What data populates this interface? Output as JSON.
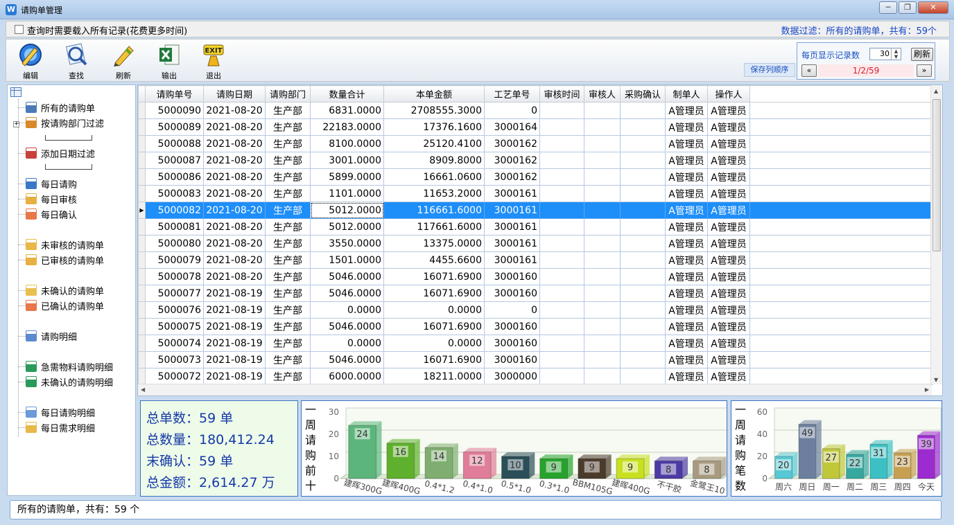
{
  "window": {
    "title": "请购单管理",
    "controls": [
      "─",
      "❐",
      "✕"
    ]
  },
  "options": {
    "load_all_label": "查询时需要载入所有记录(花费更多时间)",
    "load_all_checked": false,
    "filter_text": "数据过滤：所有的请购单，共有：59个"
  },
  "toolbar": {
    "edit": "编辑",
    "find": "查找",
    "refresh": "刷新",
    "export": "输出",
    "exit": "退出",
    "exit_badge": "EXIT",
    "save_column_order": "保存列顺序"
  },
  "pager": {
    "per_page_label": "每页显示记录数",
    "per_page_value": "30",
    "refresh": "刷新",
    "prev": "«",
    "next": "»",
    "page": "1/2/59"
  },
  "sidebar": {
    "items": [
      {
        "label": "所有的请购单",
        "icon": "form-icon"
      },
      {
        "label": "按请购部门过滤",
        "icon": "home-icon"
      },
      {
        "label": "添加日期过滤",
        "icon": "calendar-icon"
      },
      {
        "label": "每日请购",
        "icon": "edit-icon"
      },
      {
        "label": "每日审核",
        "icon": "pencil-folder-icon"
      },
      {
        "label": "每日确认",
        "icon": "heart-folder-icon"
      },
      {
        "label": "未审核的请购单",
        "icon": "open-folder-icon"
      },
      {
        "label": "已审核的请购单",
        "icon": "pencil-folder-icon"
      },
      {
        "label": "未确认的请购单",
        "icon": "grid-folder-icon"
      },
      {
        "label": "已确认的请购单",
        "icon": "heart-folder-icon"
      },
      {
        "label": "请购明细",
        "icon": "note-icon"
      },
      {
        "label": "急需物料请购明细",
        "icon": "urgent-icon"
      },
      {
        "label": "未确认的请购明细",
        "icon": "urgent-icon"
      },
      {
        "label": "每日请购明细",
        "icon": "document-icon"
      },
      {
        "label": "每日需求明细",
        "icon": "document-star-icon"
      }
    ]
  },
  "table": {
    "columns": [
      "请购单号",
      "请购日期",
      "请购部门",
      "数量合计",
      "本单金额",
      "工艺单号",
      "审核时间",
      "审核人",
      "采购确认",
      "制单人",
      "操作人"
    ],
    "rows": [
      [
        "5000090",
        "2021-08-20",
        "生产部",
        "6831.0000",
        "2708555.3000",
        "0",
        "",
        "",
        "",
        "A管理员",
        "A管理员"
      ],
      [
        "5000089",
        "2021-08-20",
        "生产部",
        "22183.0000",
        "17376.1600",
        "3000164",
        "",
        "",
        "",
        "A管理员",
        "A管理员"
      ],
      [
        "5000088",
        "2021-08-20",
        "生产部",
        "8100.0000",
        "25120.4100",
        "3000162",
        "",
        "",
        "",
        "A管理员",
        "A管理员"
      ],
      [
        "5000087",
        "2021-08-20",
        "生产部",
        "3001.0000",
        "8909.8000",
        "3000162",
        "",
        "",
        "",
        "A管理员",
        "A管理员"
      ],
      [
        "5000086",
        "2021-08-20",
        "生产部",
        "5899.0000",
        "16661.0600",
        "3000162",
        "",
        "",
        "",
        "A管理员",
        "A管理员"
      ],
      [
        "5000083",
        "2021-08-20",
        "生产部",
        "1101.0000",
        "11653.2000",
        "3000161",
        "",
        "",
        "",
        "A管理员",
        "A管理员"
      ],
      [
        "5000082",
        "2021-08-20",
        "生产部",
        "5012.0000",
        "116661.6000",
        "3000161",
        "",
        "",
        "",
        "A管理员",
        "A管理员"
      ],
      [
        "5000081",
        "2021-08-20",
        "生产部",
        "5012.0000",
        "117661.6000",
        "3000161",
        "",
        "",
        "",
        "A管理员",
        "A管理员"
      ],
      [
        "5000080",
        "2021-08-20",
        "生产部",
        "3550.0000",
        "13375.0000",
        "3000161",
        "",
        "",
        "",
        "A管理员",
        "A管理员"
      ],
      [
        "5000079",
        "2021-08-20",
        "生产部",
        "1501.0000",
        "4455.6600",
        "3000161",
        "",
        "",
        "",
        "A管理员",
        "A管理员"
      ],
      [
        "5000078",
        "2021-08-20",
        "生产部",
        "5046.0000",
        "16071.6900",
        "3000160",
        "",
        "",
        "",
        "A管理员",
        "A管理员"
      ],
      [
        "5000077",
        "2021-08-19",
        "生产部",
        "5046.0000",
        "16071.6900",
        "3000160",
        "",
        "",
        "",
        "A管理员",
        "A管理员"
      ],
      [
        "5000076",
        "2021-08-19",
        "生产部",
        "0.0000",
        "0.0000",
        "0",
        "",
        "",
        "",
        "A管理员",
        "A管理员"
      ],
      [
        "5000075",
        "2021-08-19",
        "生产部",
        "5046.0000",
        "16071.6900",
        "3000160",
        "",
        "",
        "",
        "A管理员",
        "A管理员"
      ],
      [
        "5000074",
        "2021-08-19",
        "生产部",
        "0.0000",
        "0.0000",
        "3000160",
        "",
        "",
        "",
        "A管理员",
        "A管理员"
      ],
      [
        "5000073",
        "2021-08-19",
        "生产部",
        "5046.0000",
        "16071.6900",
        "3000160",
        "",
        "",
        "",
        "A管理员",
        "A管理员"
      ],
      [
        "5000072",
        "2021-08-19",
        "生产部",
        "6000.0000",
        "18211.0000",
        "3000000",
        "",
        "",
        "",
        "A管理员",
        "A管理员"
      ]
    ],
    "selected_index": 6,
    "current_row_marker": "▶"
  },
  "summary": {
    "total_orders": "总单数：59 单",
    "total_qty": "总数量：180,412.24",
    "unconfirmed": "末确认：59 单",
    "total_amount": "总金额：2,614.27 万"
  },
  "chart_data": [
    {
      "type": "bar",
      "title": "一周请购前十",
      "categories": [
        "建晖300G",
        "建晖400G",
        "0.4*1.2",
        "0.4*1.0",
        "0.5*1.0",
        "0.3*1.0",
        "BBM105G",
        "建晖400G",
        "不干胶",
        "金鹭王10"
      ],
      "values": [
        24,
        16,
        14,
        12,
        10,
        9,
        9,
        9,
        8,
        8
      ],
      "colors": [
        "#5cb67c",
        "#5fb02c",
        "#7fae70",
        "#e07d99",
        "#2b4f59",
        "#27a22c",
        "#4b3b2b",
        "#c8e020",
        "#4c3aa4",
        "#a89a80"
      ],
      "ylim": [
        0,
        30
      ],
      "yticks": [
        0,
        10,
        20,
        30
      ],
      "grid": true
    },
    {
      "type": "bar",
      "title": "一周请购笔数",
      "categories": [
        "周六",
        "周日",
        "周一",
        "周二",
        "周三",
        "周四",
        "今天"
      ],
      "values": [
        20,
        49,
        27,
        22,
        31,
        23,
        39
      ],
      "colors": [
        "#58c8d4",
        "#6d7f9e",
        "#c0c83a",
        "#36a8a0",
        "#3cc0c4",
        "#c8a052",
        "#9c2cd0"
      ],
      "ylim": [
        0,
        60
      ],
      "yticks": [
        0,
        20,
        40,
        60
      ],
      "grid": true
    }
  ],
  "status": {
    "text": "所有的请购单，共有：59 个"
  }
}
